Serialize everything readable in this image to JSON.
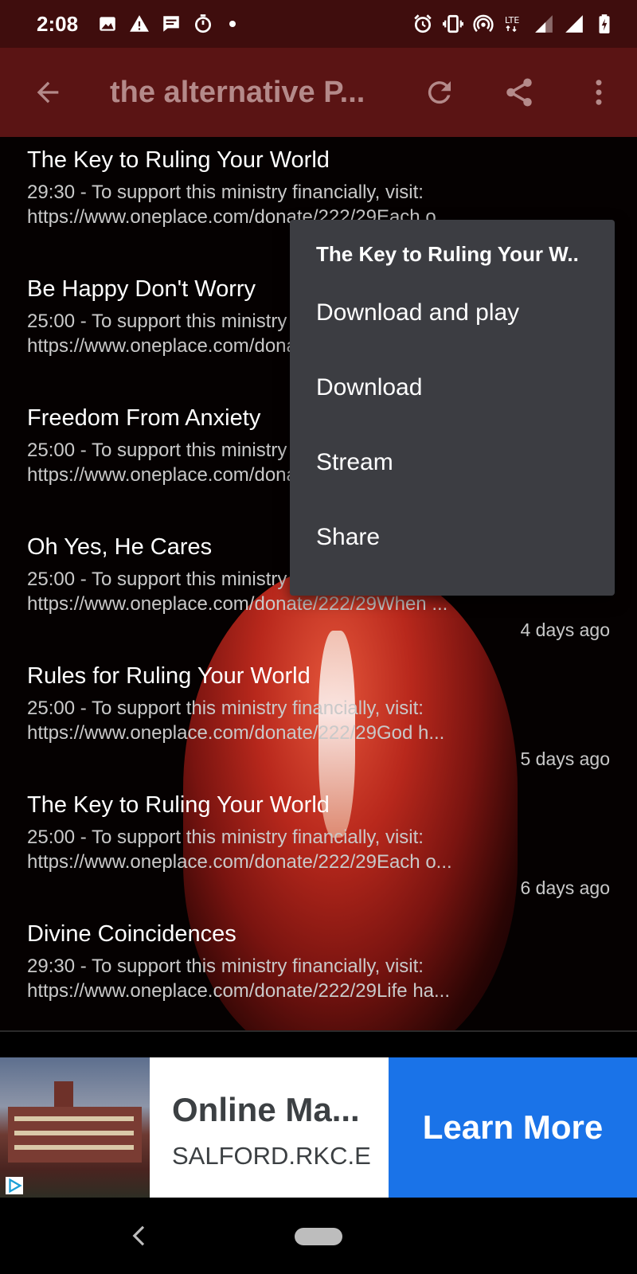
{
  "status_bar": {
    "time": "2:08",
    "left_icons": [
      "image-icon",
      "warning-icon",
      "message-icon",
      "timer-icon",
      "dot-icon"
    ],
    "right_icons": [
      "alarm-icon",
      "vibrate-icon",
      "hotspot-icon",
      "lte-icon",
      "signal-icon",
      "signal-icon",
      "battery-charging-icon"
    ],
    "network_label": "LTE"
  },
  "app_bar": {
    "title": "the alternative P...",
    "back_icon": "arrow-back-icon",
    "actions": [
      "refresh-icon",
      "share-icon",
      "more-vert-icon"
    ],
    "background": "#5a1414"
  },
  "episodes": [
    {
      "title": "The Key to Ruling Your World",
      "desc1": "29:30 - To support this ministry financially, visit:",
      "desc2": "https://www.oneplace.com/donate/222/29Each o...",
      "age": ""
    },
    {
      "title": "Be Happy Don't Worry",
      "desc1": "25:00 - To support this ministry financially, visit:",
      "desc2": "https://www.oneplace.com/donate/222/29",
      "age": ""
    },
    {
      "title": "Freedom From Anxiety",
      "desc1": "25:00 - To support this ministry financially, visit:",
      "desc2": "https://www.oneplace.com/donate/222/29",
      "age": ""
    },
    {
      "title": "Oh Yes, He Cares",
      "desc1": "25:00 - To support this ministry financially, visit:",
      "desc2": "https://www.oneplace.com/donate/222/29When ...",
      "age": "4 days ago"
    },
    {
      "title": "Rules for Ruling Your World",
      "desc1": "25:00 - To support this ministry financially, visit:",
      "desc2": "https://www.oneplace.com/donate/222/29God h...",
      "age": "5 days ago"
    },
    {
      "title": "The Key to Ruling Your World",
      "desc1": "25:00 - To support this ministry financially, visit:",
      "desc2": "https://www.oneplace.com/donate/222/29Each o...",
      "age": "6 days ago"
    },
    {
      "title": "Divine Coincidences",
      "desc1": "29:30 - To support this ministry financially, visit:",
      "desc2": "https://www.oneplace.com/donate/222/29Life ha...",
      "age": ""
    }
  ],
  "popup_menu": {
    "title": "The Key to Ruling Your W..",
    "items": [
      "Download and play",
      "Download",
      "Stream",
      "Share"
    ]
  },
  "ad": {
    "headline": "Online Ma...",
    "url": "SALFORD.RKC.E",
    "cta": "Learn More",
    "cta_color": "#1a73e8",
    "icon": "ad-choices-icon"
  },
  "nav_bar": {
    "icons": [
      "nav-back-icon",
      "nav-home-pill-icon"
    ]
  }
}
